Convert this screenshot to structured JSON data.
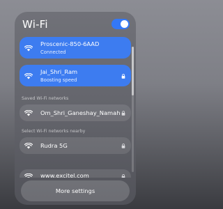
{
  "panel": {
    "title": "Wi-Fi",
    "toggle_on": true
  },
  "connected": [
    {
      "name": "Proscenic-850-6AAD",
      "status": "Connected",
      "locked": false
    },
    {
      "name": "Jai_Shri_Ram",
      "status": "Boosting speed",
      "locked": true
    }
  ],
  "saved": {
    "label": "Saved Wi-Fi networks",
    "items": [
      {
        "name": "Om_Shri_Ganeshay_Namah",
        "locked": true
      }
    ]
  },
  "nearby": {
    "label": "Select Wi-Fi networks nearby",
    "items": [
      {
        "name": "Rudra 5G",
        "locked": true
      },
      {
        "name": "www.excitel.com",
        "locked": true
      }
    ]
  },
  "footer": {
    "more_label": "More settings"
  },
  "colors": {
    "accent": "#3d7cf0"
  },
  "icons": {
    "wifi": "wifi-icon",
    "lock": "lock-icon"
  }
}
